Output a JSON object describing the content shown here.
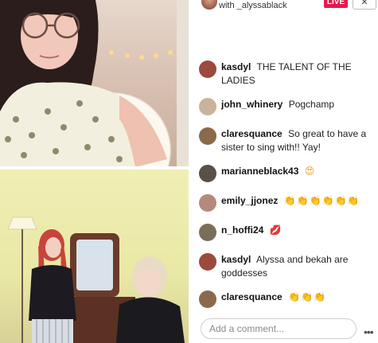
{
  "header": {
    "with_label": "with _alyssablack",
    "live_label": "LIVE",
    "close_label": "✕"
  },
  "comments": [
    {
      "user": "kasdyl",
      "text": "THE TALENT OF THE LADIES",
      "emoji": "",
      "avatar_color": "#9b4a3c"
    },
    {
      "user": "john_whinery",
      "text": "Pogchamp",
      "emoji": "",
      "avatar_color": "#c9b39a"
    },
    {
      "user": "claresquance",
      "text": "So great to have a sister to sing with!! Yay!",
      "emoji": "",
      "avatar_color": "#8a6a4a"
    },
    {
      "user": "marianneblack43",
      "text": "",
      "emoji": "😍",
      "avatar_color": "#5a5048"
    },
    {
      "user": "emily_jjonez",
      "text": "",
      "emoji": "👏👏👏👏👏👏",
      "avatar_color": "#b58a7a"
    },
    {
      "user": "n_hoffi24",
      "text": "",
      "emoji": "💋",
      "avatar_color": "#7a6e5a"
    },
    {
      "user": "kasdyl",
      "text": "Alyssa and bekah are goddesses",
      "emoji": "",
      "avatar_color": "#9b4a3c"
    },
    {
      "user": "claresquance",
      "text": "",
      "emoji": "👏👏👏",
      "avatar_color": "#8a6a4a"
    }
  ],
  "footer": {
    "comment_placeholder": "Add a comment...",
    "more_label": "•••"
  },
  "colors": {
    "live": "#e31b4c",
    "top_pane_bg": "#d9c2b4",
    "bottom_pane_bg": "#ecebaa"
  }
}
